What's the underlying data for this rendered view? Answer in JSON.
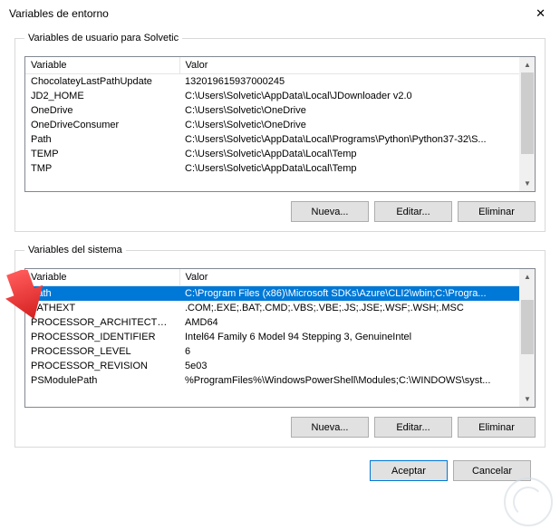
{
  "window": {
    "title": "Variables de entorno",
    "close": "✕"
  },
  "user_section": {
    "legend": "Variables de usuario para Solvetic",
    "headers": {
      "variable": "Variable",
      "value": "Valor"
    },
    "rows": [
      {
        "variable": "ChocolateyLastPathUpdate",
        "value": "132019615937000245"
      },
      {
        "variable": "JD2_HOME",
        "value": "C:\\Users\\Solvetic\\AppData\\Local\\JDownloader v2.0"
      },
      {
        "variable": "OneDrive",
        "value": "C:\\Users\\Solvetic\\OneDrive"
      },
      {
        "variable": "OneDriveConsumer",
        "value": "C:\\Users\\Solvetic\\OneDrive"
      },
      {
        "variable": "Path",
        "value": "C:\\Users\\Solvetic\\AppData\\Local\\Programs\\Python\\Python37-32\\S..."
      },
      {
        "variable": "TEMP",
        "value": "C:\\Users\\Solvetic\\AppData\\Local\\Temp"
      },
      {
        "variable": "TMP",
        "value": "C:\\Users\\Solvetic\\AppData\\Local\\Temp"
      }
    ],
    "buttons": {
      "new": "Nueva...",
      "edit": "Editar...",
      "delete": "Eliminar"
    }
  },
  "system_section": {
    "legend": "Variables del sistema",
    "headers": {
      "variable": "Variable",
      "value": "Valor"
    },
    "rows": [
      {
        "variable": "Path",
        "value": "C:\\Program Files (x86)\\Microsoft SDKs\\Azure\\CLI2\\wbin;C:\\Progra...",
        "selected": true
      },
      {
        "variable": "PATHEXT",
        "value": ".COM;.EXE;.BAT;.CMD;.VBS;.VBE;.JS;.JSE;.WSF;.WSH;.MSC"
      },
      {
        "variable": "PROCESSOR_ARCHITECTURE",
        "value": "AMD64"
      },
      {
        "variable": "PROCESSOR_IDENTIFIER",
        "value": "Intel64 Family 6 Model 94 Stepping 3, GenuineIntel"
      },
      {
        "variable": "PROCESSOR_LEVEL",
        "value": "6"
      },
      {
        "variable": "PROCESSOR_REVISION",
        "value": "5e03"
      },
      {
        "variable": "PSModulePath",
        "value": "%ProgramFiles%\\WindowsPowerShell\\Modules;C:\\WINDOWS\\syst..."
      }
    ],
    "buttons": {
      "new": "Nueva...",
      "edit": "Editar...",
      "delete": "Eliminar"
    }
  },
  "dialog_buttons": {
    "ok": "Aceptar",
    "cancel": "Cancelar"
  },
  "scrollbar": {
    "up": "▲",
    "down": "▼"
  }
}
